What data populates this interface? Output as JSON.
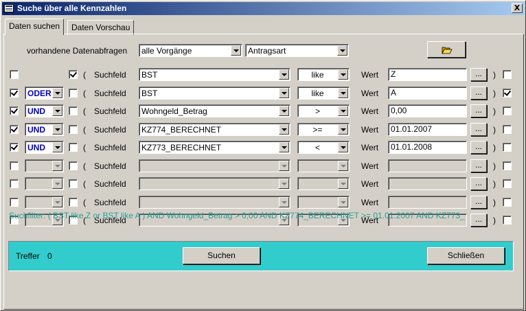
{
  "window": {
    "title": "Suche über alle Kennzahlen",
    "close_label": "X"
  },
  "tabs": [
    {
      "label": "Daten suchen"
    },
    {
      "label": "Daten Vorschau"
    }
  ],
  "query": {
    "label": "vorhandene Datenabfragen",
    "selection1": "alle Vorgänge",
    "selection2": "Antragsart"
  },
  "rows": [
    {
      "row_check": false,
      "operator": "",
      "group_check": true,
      "paren_open": "(",
      "field_label": "Suchfeld",
      "field": "BST",
      "comparator": "like",
      "value_label": "Wert",
      "value": "Z",
      "dots": "...",
      "paren_close": ")",
      "end_check": false
    },
    {
      "row_check": true,
      "operator": "ODER",
      "group_check": false,
      "paren_open": "(",
      "field_label": "Suchfeld",
      "field": "BST",
      "comparator": "like",
      "value_label": "Wert",
      "value": "A",
      "dots": "...",
      "paren_close": ")",
      "end_check": true
    },
    {
      "row_check": true,
      "operator": "UND",
      "group_check": false,
      "paren_open": "(",
      "field_label": "Suchfeld",
      "field": "Wohngeld_Betrag",
      "comparator": ">",
      "value_label": "Wert",
      "value": "0,00",
      "dots": "...",
      "paren_close": ")",
      "end_check": false
    },
    {
      "row_check": true,
      "operator": "UND",
      "group_check": false,
      "paren_open": "(",
      "field_label": "Suchfeld",
      "field": "KZ774_BERECHNET",
      "comparator": ">=",
      "value_label": "Wert",
      "value": "01.01.2007",
      "dots": "...",
      "paren_close": ")",
      "end_check": false
    },
    {
      "row_check": true,
      "operator": "UND",
      "group_check": false,
      "paren_open": "(",
      "field_label": "Suchfeld",
      "field": "KZ773_BERECHNET",
      "comparator": "<",
      "value_label": "Wert",
      "value": "01.01.2008",
      "dots": "...",
      "paren_close": ")",
      "end_check": false
    },
    {
      "row_check": false,
      "operator": "",
      "group_check": false,
      "paren_open": "(",
      "field_label": "Suchfeld",
      "field": "",
      "comparator": "",
      "value_label": "Wert",
      "value": "",
      "dots": "...",
      "paren_close": ")",
      "end_check": false
    },
    {
      "row_check": false,
      "operator": "",
      "group_check": false,
      "paren_open": "(",
      "field_label": "Suchfeld",
      "field": "",
      "comparator": "",
      "value_label": "Wert",
      "value": "",
      "dots": "...",
      "paren_close": ")",
      "end_check": false
    },
    {
      "row_check": false,
      "operator": "",
      "group_check": false,
      "paren_open": "(",
      "field_label": "Suchfeld",
      "field": "",
      "comparator": "",
      "value_label": "Wert",
      "value": "",
      "dots": "...",
      "paren_close": ")",
      "end_check": false
    },
    {
      "row_check": false,
      "operator": "",
      "group_check": false,
      "paren_open": "(",
      "field_label": "Suchfeld",
      "field": "",
      "comparator": "",
      "value_label": "Wert",
      "value": "",
      "dots": "...",
      "paren_close": ")",
      "end_check": false
    }
  ],
  "filter_text": "Suchfilter:  ( BST like Z or BST like A )  AND Wohngeld_Betrag > 0,00 AND KZ774_BERECHNET >= 01.01.2007 AND KZ773_",
  "bottom": {
    "hits_label": "Treffer",
    "hits_count": "0",
    "search_button": "Suchen",
    "close_button": "Schließen"
  },
  "colors": {
    "title_start": "#0a246a",
    "title_end": "#a6caf0",
    "panel": "#d4d0c8",
    "filter_text": "#2a9d8f",
    "bottom_bar": "#33cccc",
    "operator_text": "#0000c0"
  },
  "icons": {
    "open_folder": "open-folder-icon",
    "window": "form-window-icon"
  }
}
